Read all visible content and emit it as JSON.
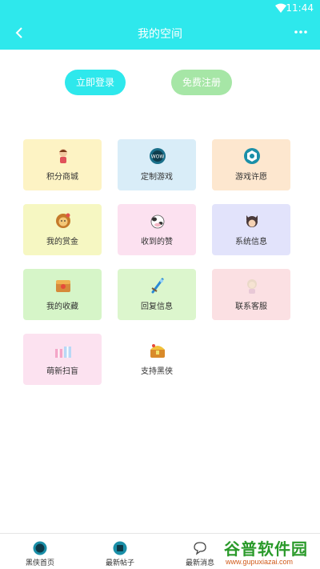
{
  "status_bar": {
    "time": "11:44"
  },
  "app_bar": {
    "title": "我的空间",
    "back_icon": "chevron-left-icon",
    "more_icon": "more-horizontal-icon"
  },
  "auth": {
    "login_label": "立即登录",
    "register_label": "免费注册"
  },
  "menu": {
    "items": [
      {
        "label": "积分商城",
        "icon": "character-icon",
        "bg": "#fdf3c4"
      },
      {
        "label": "定制游戏",
        "icon": "wow-badge-icon",
        "bg": "#d9edf8"
      },
      {
        "label": "游戏许愿",
        "icon": "hex-gear-icon",
        "bg": "#fde7cf"
      },
      {
        "label": "我的赏金",
        "icon": "lion-icon",
        "bg": "#f6f7c2"
      },
      {
        "label": "收到的赞",
        "icon": "cow-icon",
        "bg": "#fce1f0"
      },
      {
        "label": "系统信息",
        "icon": "cat-icon",
        "bg": "#e2e3fb"
      },
      {
        "label": "我的收藏",
        "icon": "treasure-box-icon",
        "bg": "#d6f5c8"
      },
      {
        "label": "回复信息",
        "icon": "sword-icon",
        "bg": "#dcf6cd"
      },
      {
        "label": "联系客服",
        "icon": "girl-icon",
        "bg": "#fbe0e3"
      },
      {
        "label": "萌新扫盲",
        "icon": "gift-boxes-icon",
        "bg": "#fce2f0"
      },
      {
        "label": "支持黑侠",
        "icon": "treasure-chest-icon",
        "bg": "#ffffff"
      }
    ]
  },
  "bottom_nav": {
    "items": [
      {
        "label": "黑侠首页",
        "icon": "home-logo-icon"
      },
      {
        "label": "最新帖子",
        "icon": "post-icon"
      },
      {
        "label": "最新消息",
        "icon": "chat-icon"
      }
    ]
  },
  "watermark": {
    "text": "谷普软件园",
    "url": "www.gupuxiazai.com"
  }
}
